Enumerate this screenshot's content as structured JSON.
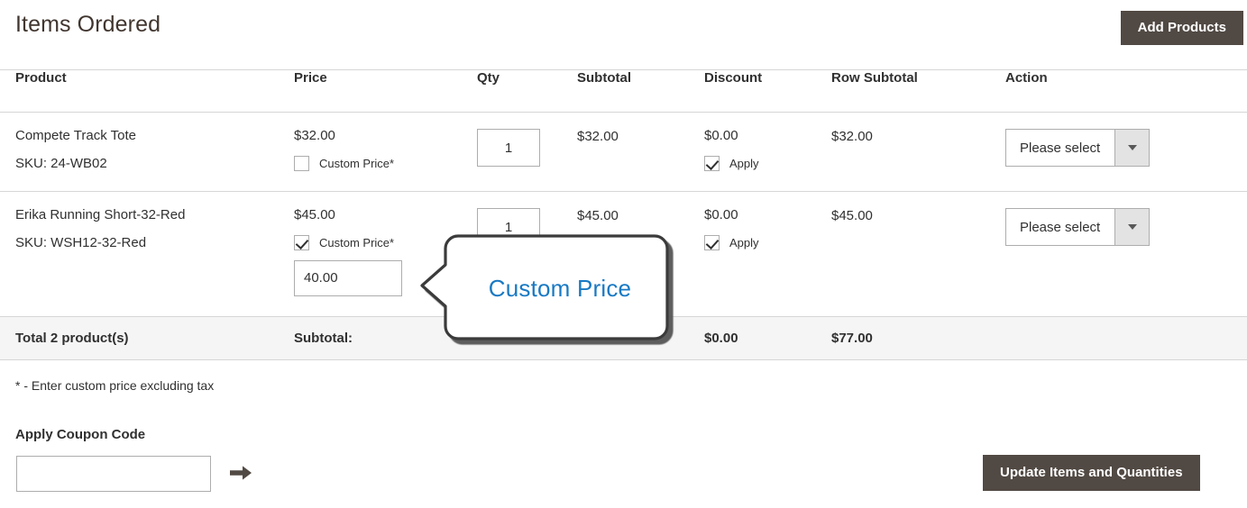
{
  "header": {
    "title": "Items Ordered",
    "add_products_label": "Add Products"
  },
  "table": {
    "columns": {
      "product": "Product",
      "price": "Price",
      "qty": "Qty",
      "subtotal": "Subtotal",
      "discount": "Discount",
      "row_subtotal": "Row Subtotal",
      "action": "Action"
    },
    "rows": [
      {
        "name": "Compete Track Tote",
        "sku": "SKU: 24-WB02",
        "price": "$32.00",
        "custom_price_label": "Custom Price*",
        "custom_price_checked": false,
        "custom_price_value": "",
        "qty": "1",
        "subtotal": "$32.00",
        "discount": "$0.00",
        "apply_label": "Apply",
        "apply_checked": true,
        "row_subtotal": "$32.00",
        "action_select_value": "Please select"
      },
      {
        "name": "Erika Running Short-32-Red",
        "sku": "SKU: WSH12-32-Red",
        "price": "$45.00",
        "custom_price_label": "Custom Price*",
        "custom_price_checked": true,
        "custom_price_value": "40.00",
        "qty": "1",
        "subtotal": "$45.00",
        "discount": "$0.00",
        "apply_label": "Apply",
        "apply_checked": true,
        "row_subtotal": "$45.00",
        "action_select_value": "Please select"
      }
    ],
    "totals": {
      "products_label": "Total 2 product(s)",
      "subtotal_label": "Subtotal:",
      "discount": "$0.00",
      "row_subtotal": "$77.00"
    }
  },
  "footnote": "* - Enter custom price excluding tax",
  "coupon": {
    "label": "Apply Coupon Code",
    "value": "",
    "placeholder": "",
    "submit_icon": "arrow-right-icon"
  },
  "update_button_label": "Update Items and Quantities",
  "callout": {
    "text": "Custom Price",
    "text_color": "#1979c3"
  },
  "colors": {
    "button_bg": "#514943",
    "totals_bg": "#f5f5f5",
    "border": "#d6d6d6"
  }
}
